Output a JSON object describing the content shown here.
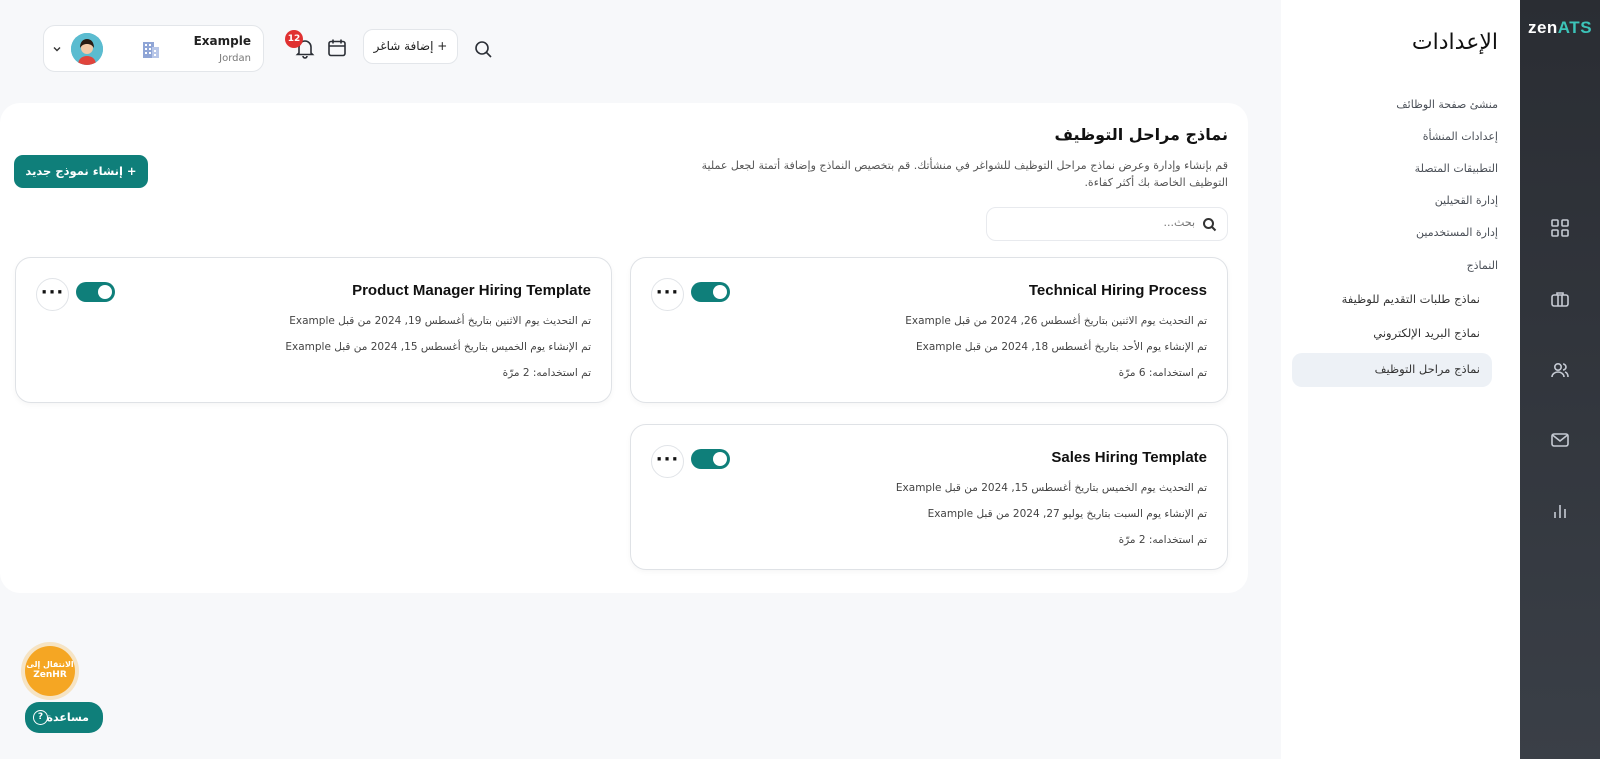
{
  "brand": {
    "logo_zen": "zen",
    "logo_ats": "ATS"
  },
  "settings_sidebar": {
    "title": "الإعدادات",
    "items": [
      {
        "label": "منشئ صفحة الوظائف"
      },
      {
        "label": "إعدادات المنشأة"
      },
      {
        "label": "التطبيقات المتصلة"
      },
      {
        "label": "إدارة القحيلين"
      },
      {
        "label": "إدارة المستخدمين"
      },
      {
        "label": "النماذج"
      }
    ],
    "sub_items": [
      {
        "label": "نماذج طلبات التقديم للوظيفة"
      },
      {
        "label": "نماذج البريد الإلكتروني"
      },
      {
        "label": "نماذج مراحل التوظيف",
        "active": true
      }
    ]
  },
  "rail_icons": [
    "grid-icon",
    "briefcase-icon",
    "users-icon",
    "mail-icon",
    "chart-icon"
  ],
  "header": {
    "org_name": "Example",
    "org_country": "Jordan",
    "notifications_count": "12",
    "add_candidate_label": "+ إضافة شاغر"
  },
  "main": {
    "title": "نماذج مراحل التوظيف",
    "description": "قم بإنشاء وإدارة وعرض نماذج مراحل التوظيف للشواغر في منشأتك. قم بتخصيص النماذج وإضافة أتمتة لجعل عملية التوظيف الخاصة بك أكثر كفاءة.",
    "create_button": "+ إنشاء نموذج جديد",
    "search_placeholder": "بحث..."
  },
  "templates": [
    {
      "name": "Technical Hiring Process",
      "updated": "تم التحديث يوم الاثنين بتاريخ أغسطس 26, 2024 من قبل Example",
      "created": "تم الإنشاء يوم الأحد بتاريخ أغسطس 18, 2024 من قبل Example",
      "usage": "تم استخدامه: 6 مرّة",
      "enabled": true
    },
    {
      "name": "Product Manager Hiring Template",
      "updated": "تم التحديث يوم الاثنين بتاريخ أغسطس 19, 2024 من قبل Example",
      "created": "تم الإنشاء يوم الخميس بتاريخ أغسطس 15, 2024 من قبل Example",
      "usage": "تم استخدامه: 2 مرّة",
      "enabled": true
    },
    {
      "name": "Sales Hiring Template",
      "updated": "تم التحديث يوم الخميس بتاريخ أغسطس 15, 2024 من قبل Example",
      "created": "تم الإنشاء يوم السبت بتاريخ يوليو 27, 2024 من قبل Example",
      "usage": "تم استخدامه: 2 مرّة",
      "enabled": true
    }
  ],
  "floating": {
    "zenhr_line1": "الانتقال إلى",
    "zenhr_line2": "ZenHR",
    "help_label": "مساعدة"
  },
  "colors": {
    "primary": "#0f7f7a",
    "rail": "#2a2d33",
    "accent_orange": "#f5a623",
    "badge_red": "#e03131"
  }
}
